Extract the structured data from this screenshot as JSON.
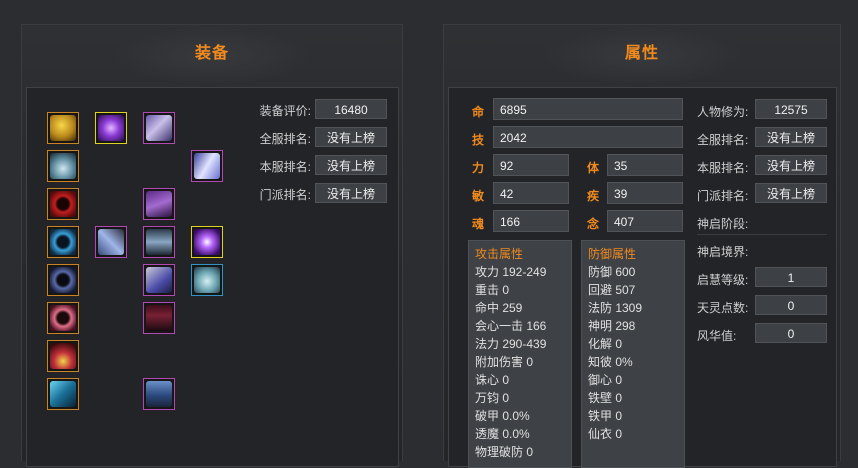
{
  "equipment": {
    "title": "装备",
    "slots": [
      {
        "icon": "amulet-icon",
        "quality": "orange"
      },
      {
        "icon": "magic-orb-icon",
        "quality": "yellow"
      },
      {
        "icon": "helmet-icon",
        "quality": "purple"
      },
      {
        "icon": "pendant-icon",
        "quality": "orange"
      },
      {
        "icon": "wings-icon",
        "quality": "purple"
      },
      {
        "icon": "red-bracelet-icon",
        "quality": "orange"
      },
      {
        "icon": "armor-icon",
        "quality": "purple"
      },
      {
        "icon": "blue-ring-icon",
        "quality": "orange"
      },
      {
        "icon": "weapon-icon",
        "quality": "purple"
      },
      {
        "icon": "belt-icon",
        "quality": "purple"
      },
      {
        "icon": "purple-orb-icon",
        "quality": "yellow"
      },
      {
        "icon": "dark-ring-icon",
        "quality": "orange"
      },
      {
        "icon": "gloves-icon",
        "quality": "purple"
      },
      {
        "icon": "potion-bag-icon",
        "quality": "blue"
      },
      {
        "icon": "ruby-ring-icon",
        "quality": "orange"
      },
      {
        "icon": "pants-icon",
        "quality": "purple"
      },
      {
        "icon": "necklace-icon",
        "quality": "orange"
      },
      {
        "icon": "gem-icon",
        "quality": "orange"
      },
      {
        "icon": "boots-icon",
        "quality": "purple"
      }
    ],
    "stats": [
      {
        "label": "装备评价:",
        "value": "16480"
      },
      {
        "label": "全服排名:",
        "value": "没有上榜"
      },
      {
        "label": "本服排名:",
        "value": "没有上榜"
      },
      {
        "label": "门派排名:",
        "value": "没有上榜"
      }
    ]
  },
  "attributes": {
    "title": "属性",
    "ming": {
      "char": "命",
      "value": "6895"
    },
    "ji": {
      "char": "技",
      "value": "2042"
    },
    "li": {
      "char": "力",
      "value": "92"
    },
    "ti": {
      "char": "体",
      "value": "35"
    },
    "min": {
      "char": "敏",
      "value": "42"
    },
    "ji2": {
      "char": "疾",
      "value": "39"
    },
    "hun": {
      "char": "魂",
      "value": "166"
    },
    "nian": {
      "char": "念",
      "value": "407"
    },
    "attack": {
      "title": "攻击属性",
      "rows": [
        "攻力 192-249",
        "重击 0",
        "命中 259",
        "会心一击 166",
        "法力 290-439",
        "附加伤害 0",
        "诛心 0",
        "万钧 0",
        "破甲 0.0%",
        "透魔 0.0%",
        "物理破防 0"
      ]
    },
    "defense": {
      "title": "防御属性",
      "rows": [
        "防御 600",
        "回避 507",
        "法防 1309",
        "神明 298",
        "化解 0",
        "知彼 0%",
        "御心 0",
        "铁壁 0",
        "铁甲 0",
        "仙衣 0"
      ]
    },
    "right": [
      {
        "label": "人物修为:",
        "value": "12575"
      },
      {
        "label": "全服排名:",
        "value": "没有上榜"
      },
      {
        "label": "本服排名:",
        "value": "没有上榜"
      },
      {
        "label": "门派排名:",
        "value": "没有上榜"
      }
    ],
    "shenqi_stage": "神启阶段:",
    "shenqi_realm": "神启境界:",
    "extra": [
      {
        "label": "启慧等级:",
        "value": "1"
      },
      {
        "label": "天灵点数:",
        "value": "0"
      },
      {
        "label": "风华值:",
        "value": "0"
      }
    ]
  }
}
